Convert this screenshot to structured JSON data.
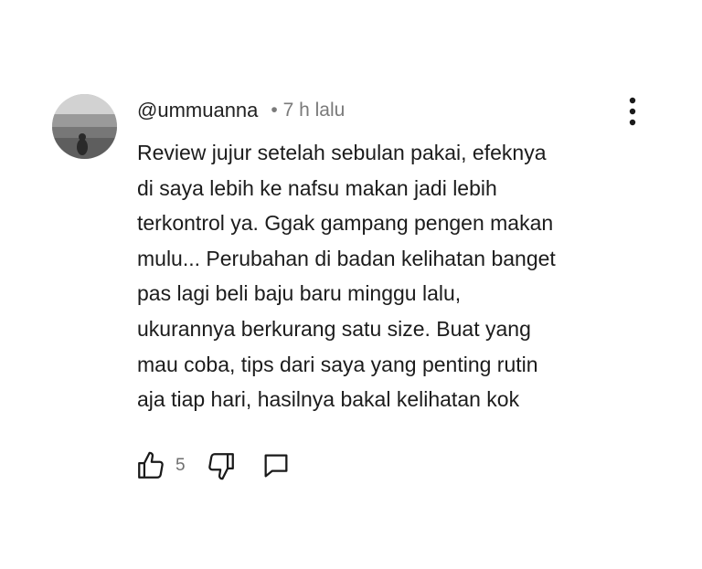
{
  "comment": {
    "author": "@ummuanna",
    "meta": "• 7 h lalu",
    "text": "Review jujur setelah sebulan pakai, efeknya\ndi saya lebih ke nafsu makan jadi lebih\nterkontrol ya. Ggak gampang pengen makan\nmulu... Perubahan di badan kelihatan banget\npas lagi beli baju baru minggu lalu,\nukurannya berkurang satu size. Buat yang\nmau coba, tips dari saya yang penting rutin\naja tiap hari, hasilnya bakal kelihatan kok",
    "like_count": "5"
  },
  "icons": {
    "menu": "more-vert-icon",
    "like": "thumbs-up-icon",
    "dislike": "thumbs-down-icon",
    "reply": "comment-icon"
  },
  "colors": {
    "author": "#222222",
    "meta": "#7a7a7a",
    "text": "#1c1c1c",
    "icon": "#1a1a1a"
  }
}
